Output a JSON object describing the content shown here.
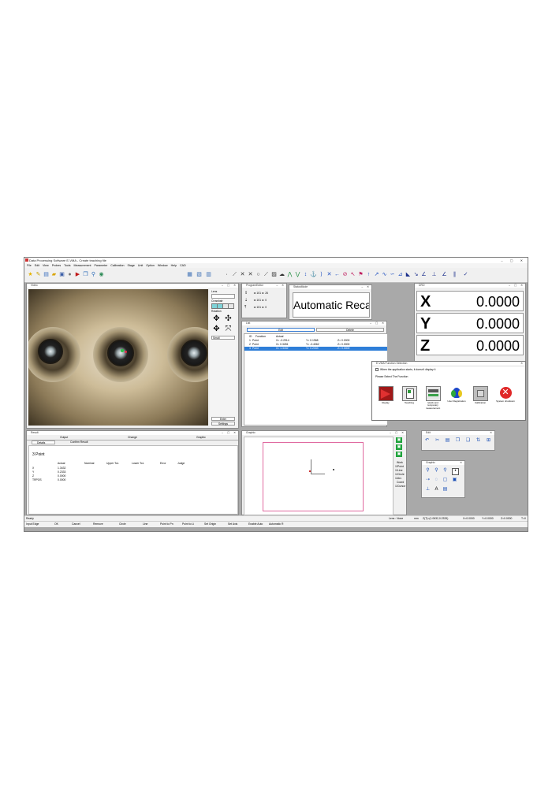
{
  "window": {
    "title": "Data Processing Software E-VMA - Create teaching file"
  },
  "menu": [
    "File",
    "Edit",
    "View",
    "Probes",
    "Tools",
    "Measurement",
    "Parameter",
    "Calibration",
    "Stage",
    "Unit",
    "Option",
    "Window",
    "Help",
    "CAD"
  ],
  "toolbar_icons": [
    "star-icon",
    "pencil-icon",
    "new-file-icon",
    "open-folder-icon",
    "save-icon",
    "record-icon",
    "play-icon",
    "copy-icon",
    "zoom-icon",
    "camera-icon"
  ],
  "image_panel": {
    "title": "Video",
    "side": {
      "lens_label": "Lens",
      "crosshair_label": "Crosshair",
      "rotation_label": "Rotation",
      "size_option": "Small",
      "enter_button": "Enter",
      "settings_button": "Settings"
    }
  },
  "program_panel": {
    "title": "ProgramEditor",
    "rows": [
      {
        "icon": "◄",
        "text": "101",
        "arrow": "►",
        "value": "26"
      },
      {
        "icon": "◄",
        "text": "101",
        "arrow": "►",
        "value": "0"
      },
      {
        "icon": "◄",
        "text": "101",
        "arrow": "►",
        "value": "0"
      }
    ]
  },
  "status_panel": {
    "title": "StatusMode",
    "message": "Automatic Recall"
  },
  "dro": {
    "title": "DRO",
    "rows": [
      {
        "axis": "X",
        "value": "0.0000"
      },
      {
        "axis": "Y",
        "value": "0.0000"
      },
      {
        "axis": "Z",
        "value": "0.0000"
      }
    ]
  },
  "list_panel": {
    "title": "List",
    "edit_button": "Edit",
    "delete_button": "Delete",
    "headers": [
      "ID",
      "Function",
      "Actual"
    ],
    "rows": [
      {
        "id": "1",
        "func": "Point",
        "x": "X= -0.2914",
        "y": "Y= 0.1968",
        "z": "Z= 0.0000"
      },
      {
        "id": "2",
        "func": "Point",
        "x": "X= 0.3281",
        "y": "Y= -0.4062",
        "z": "Z= 0.0000"
      },
      {
        "id": "3",
        "func": "Point",
        "x": "X= 1.3432",
        "y": "Y= 0.2333",
        "z": "Z= 0.0000"
      }
    ]
  },
  "function_dialog": {
    "title": "E-VMA Function Selection",
    "checkbox_label": "When the application starts, it doesn't display it",
    "prompt": "Please Select The Function",
    "functions": [
      {
        "label": "Replay",
        "icon": "replay-icon"
      },
      {
        "label": "Teaching",
        "icon": "teaching-icon"
      },
      {
        "label": "Quick and temporary measurement",
        "icon": "quick-measure-icon"
      },
      {
        "label": "User Registration",
        "icon": "user-registration-icon"
      },
      {
        "label": "Calibration",
        "icon": "calibration-icon"
      },
      {
        "label": "System shutdown",
        "icon": "shutdown-icon"
      }
    ]
  },
  "result_panel": {
    "title": "Result",
    "tabs": [
      "Output",
      "Change",
      "Graphic"
    ],
    "subtabs": [
      "Details",
      "Confirm Result"
    ],
    "item": "3   Point",
    "headers": [
      "Actual",
      "Nominal",
      "Upper ToL",
      "Lower ToL",
      "Error",
      "Judge"
    ],
    "rows": [
      {
        "label": "X",
        "actual": "1.3432"
      },
      {
        "label": "Y",
        "actual": "0.2333"
      },
      {
        "label": "Z",
        "actual": "0.0000"
      },
      {
        "label": "TRPOS",
        "actual": "0.0000"
      }
    ]
  },
  "graphic_panel": {
    "title": "Graphic",
    "side_items": [
      "Work",
      "Point",
      "Line",
      "Circle",
      "Arc",
      "Coord",
      "Cursor"
    ]
  },
  "edit_panel": {
    "title": "Edit"
  },
  "graphic_tools": {
    "title": "Graphic"
  },
  "status_bar": {
    "left": "Ready",
    "lens": "Lens : None",
    "unit": "mm",
    "coord": "Z(T)=(1.0632,0.2333)",
    "x": "X=0.0000",
    "y": "Y=0.0000",
    "z": "Z=0.0000",
    "t": "T=0"
  },
  "function_keys": [
    "Input Edge",
    "OK",
    "Cancel",
    "Remove",
    "Circle",
    "Line",
    "Point to Pn",
    "Point to Li",
    "Set Origin",
    "Set Axis",
    "Enable Auto",
    "Automatic R"
  ]
}
